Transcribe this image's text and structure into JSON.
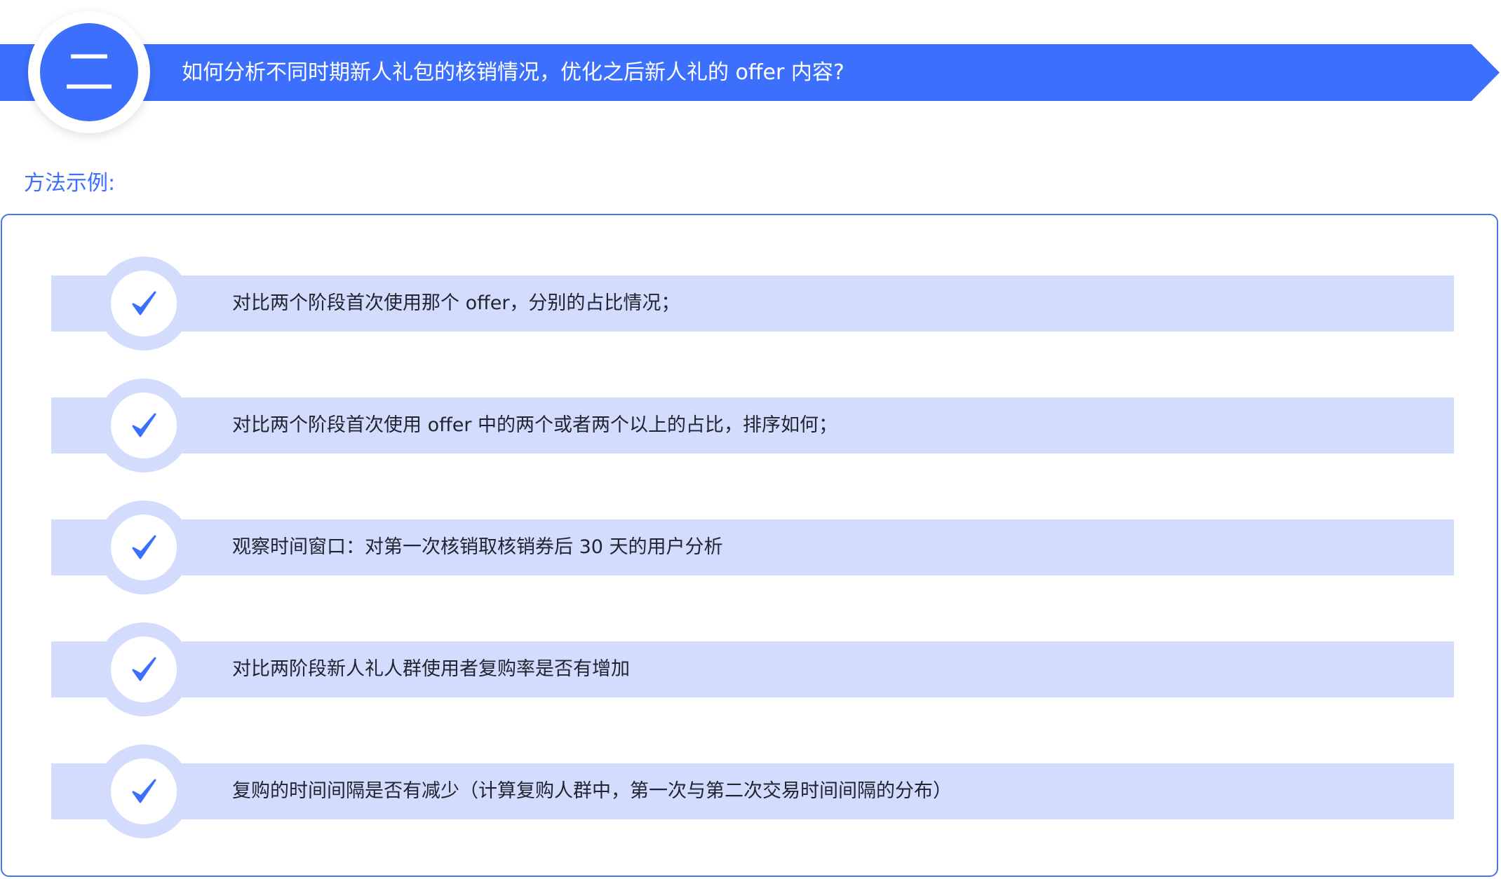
{
  "header": {
    "badge_number": "二",
    "title": "如何分析不同时期新人礼包的核销情况，优化之后新人礼的 offer 内容?",
    "colors": {
      "primary": "#3b6ffc",
      "item_background": "#d3dcfd"
    }
  },
  "section": {
    "label": "方法示例:"
  },
  "items": [
    {
      "icon": "checkmark-icon",
      "text": "对比两个阶段首次使用那个 offer，分别的占比情况；"
    },
    {
      "icon": "checkmark-icon",
      "text": "对比两个阶段首次使用 offer 中的两个或者两个以上的占比，排序如何；"
    },
    {
      "icon": "checkmark-icon",
      "text": "观察时间窗口：对第一次核销取核销券后 30 天的用户分析"
    },
    {
      "icon": "checkmark-icon",
      "text": "对比两阶段新人礼人群使用者复购率是否有增加"
    },
    {
      "icon": "checkmark-icon",
      "text": "复购的时间间隔是否有减少（计算复购人群中，第一次与第二次交易时间间隔的分布）"
    }
  ]
}
